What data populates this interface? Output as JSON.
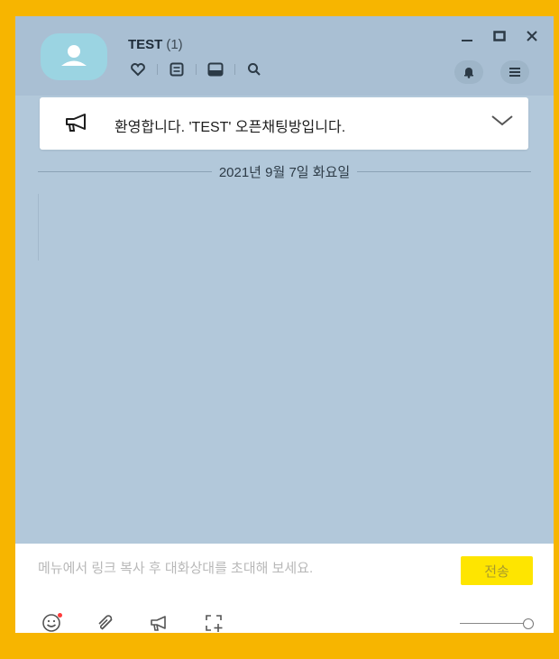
{
  "header": {
    "title": "TEST",
    "count": "(1)",
    "icons": [
      "heart-icon",
      "notes-icon",
      "album-icon",
      "search-icon"
    ],
    "window_controls": [
      "minimize-icon",
      "maximize-icon",
      "close-icon"
    ],
    "right_buttons": [
      "bell-icon",
      "menu-icon"
    ]
  },
  "notice": {
    "icon": "megaphone-icon",
    "text": "환영합니다. 'TEST' 오픈채팅방입니다.",
    "expand_icon": "chevron-down-icon"
  },
  "chat": {
    "date_divider": "2021년 9월 7일 화요일"
  },
  "compose": {
    "placeholder": "메뉴에서 링크 복사 후 대화상대를 초대해 보세요.",
    "send_label": "전송",
    "tools": [
      "emoticon-icon",
      "attach-icon",
      "announce-icon",
      "capture-icon"
    ],
    "emoticon_has_badge": true
  },
  "colors": {
    "frame": "#f7b500",
    "chat_bg": "#b2c8da",
    "header_bg": "#a9bfd3",
    "send_bg": "#fee500"
  }
}
